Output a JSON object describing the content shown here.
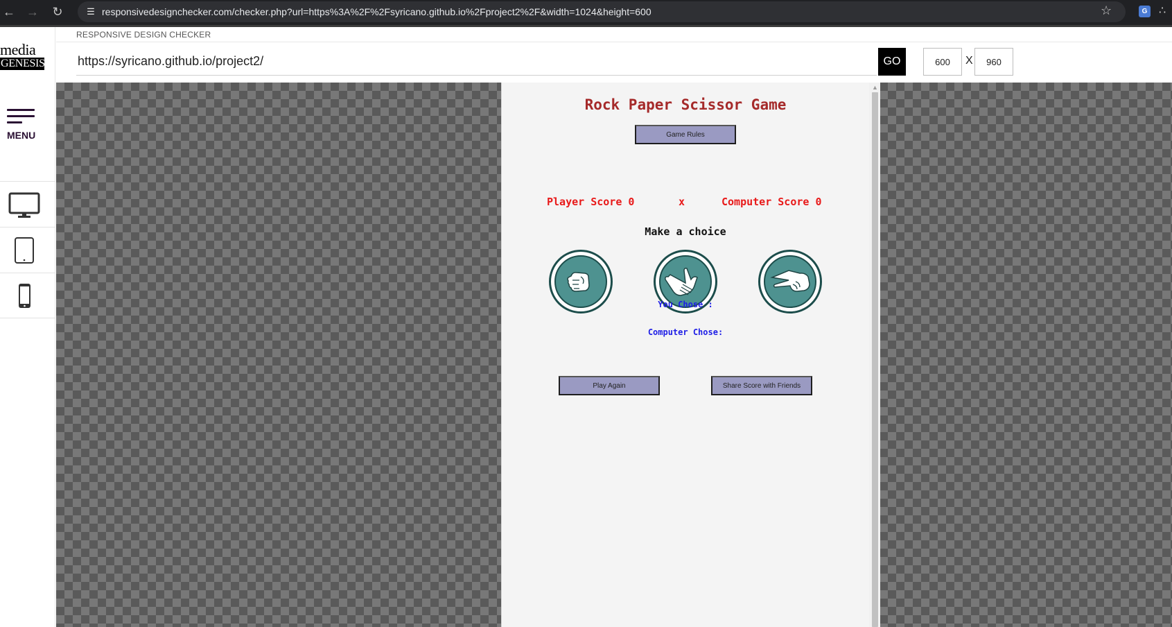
{
  "browser": {
    "url": "responsivedesignchecker.com/checker.php?url=https%3A%2F%2Fsyricano.github.io%2Fproject2%2F&width=1024&height=600"
  },
  "sidebar": {
    "logo_top": "media",
    "logo_bottom": "GENESIS",
    "menu_label": "MENU",
    "devices": [
      "desktop-icon",
      "tablet-icon",
      "phone-icon"
    ]
  },
  "header": {
    "title": "RESPONSIVE DESIGN CHECKER",
    "url_value": "https://syricano.github.io/project2/",
    "go_label": "GO",
    "width_value": "600",
    "x_label": "X",
    "height_value": "960"
  },
  "game": {
    "title": "Rock Paper Scissor Game",
    "rules_button": "Game Rules",
    "player_score": "Player Score 0",
    "versus": "x",
    "computer_score": "Computer Score 0",
    "choice_heading": "Make a choice",
    "choices": [
      "rock-icon",
      "paper-icon",
      "scissors-icon"
    ],
    "you_chose": "You Chose :",
    "computer_chose": "Computer Chose:",
    "play_again": "Play Again",
    "share": "Share Score with Friends"
  },
  "colors": {
    "title": "#a52a2a",
    "score": "#e81a1a",
    "chose": "#1e1ee6",
    "button": "#9a9ac2",
    "choice_fill": "#4e9290"
  }
}
